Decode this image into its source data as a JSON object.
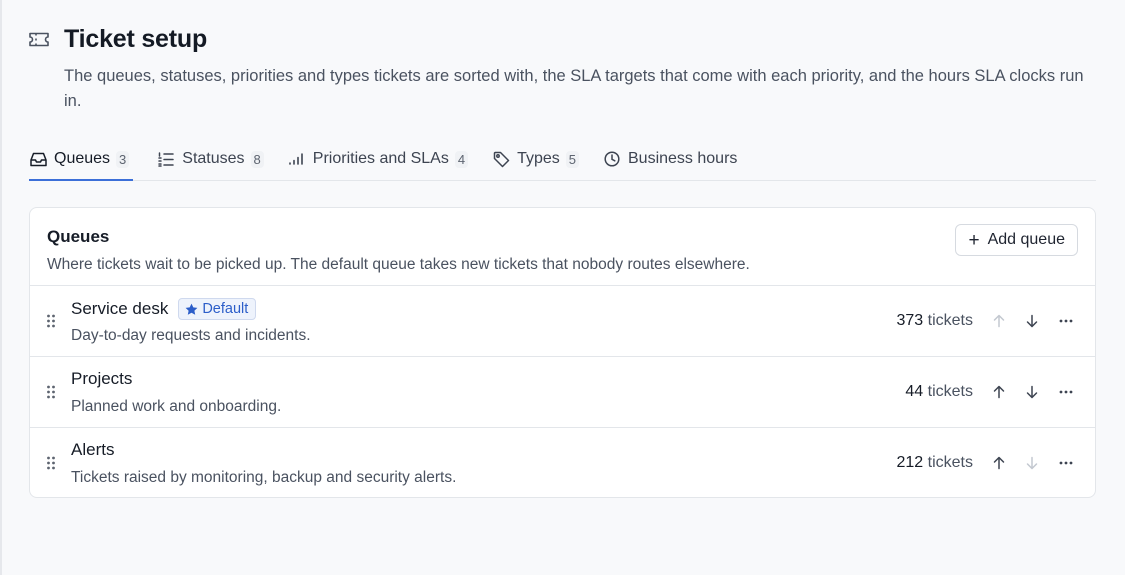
{
  "header": {
    "title": "Ticket setup",
    "description": "The queues, statuses, priorities and types tickets are sorted with, the SLA targets that come with each priority, and the hours SLA clocks run in."
  },
  "tabs": [
    {
      "label": "Queues",
      "count": "3",
      "icon": "inbox-icon",
      "active": true
    },
    {
      "label": "Statuses",
      "count": "8",
      "icon": "list-icon"
    },
    {
      "label": "Priorities and SLAs",
      "count": "4",
      "icon": "signal-bars-icon"
    },
    {
      "label": "Types",
      "count": "5",
      "icon": "tag-icon"
    },
    {
      "label": "Business hours",
      "icon": "clock-icon"
    }
  ],
  "queues_card": {
    "title": "Queues",
    "description": "Where tickets wait to be picked up. The default queue takes new tickets that nobody routes elsewhere.",
    "add_label": "Add queue",
    "default_badge": "Default",
    "tickets_suffix": "tickets",
    "rows": [
      {
        "name": "Service desk",
        "description": "Day-to-day requests and incidents.",
        "count": "373",
        "is_default": true,
        "can_move_up": false,
        "can_move_down": true
      },
      {
        "name": "Projects",
        "description": "Planned work and onboarding.",
        "count": "44",
        "is_default": false,
        "can_move_up": true,
        "can_move_down": true
      },
      {
        "name": "Alerts",
        "description": "Tickets raised by monitoring, backup and security alerts.",
        "count": "212",
        "is_default": false,
        "can_move_up": true,
        "can_move_down": false
      }
    ]
  },
  "colors": {
    "accent": "#3b6fd8",
    "badge_text": "#2c5ec9",
    "badge_bg": "#eef3fc",
    "disabled_icon": "#c3c8d0",
    "enabled_icon": "#3d4451"
  }
}
